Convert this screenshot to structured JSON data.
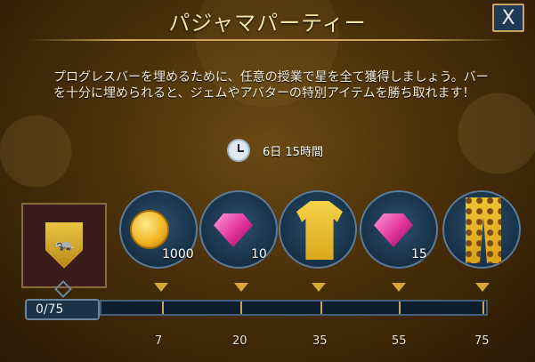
{
  "event": {
    "title": "パジャマパーティー",
    "close_label": "X",
    "description": "プログレスバーを埋めるために、任意の授業で星を全て獲得しましょう。バーを十分に埋められると、ジェムやアバターの特別アイテムを勝ち取れます！",
    "timer": "6日 15時間"
  },
  "progress": {
    "label": "0/75",
    "current": 0,
    "max": 75
  },
  "rewards": [
    {
      "name": "coins",
      "icon": "coin-icon",
      "amount": "1000",
      "milestone": "7"
    },
    {
      "name": "gems",
      "icon": "gem-icon",
      "amount": "10",
      "milestone": "20"
    },
    {
      "name": "pajama-shirt",
      "icon": "shirt-icon",
      "amount": "",
      "milestone": "35"
    },
    {
      "name": "gems",
      "icon": "gem-icon",
      "amount": "15",
      "milestone": "55"
    },
    {
      "name": "pajama-pants",
      "icon": "pants-icon",
      "amount": "",
      "milestone": "75"
    }
  ],
  "colors": {
    "background": "#4a3009",
    "accent_gold": "#c9a45a",
    "bar_track": "#0f1e2c",
    "reward_bubble": "#173047"
  }
}
